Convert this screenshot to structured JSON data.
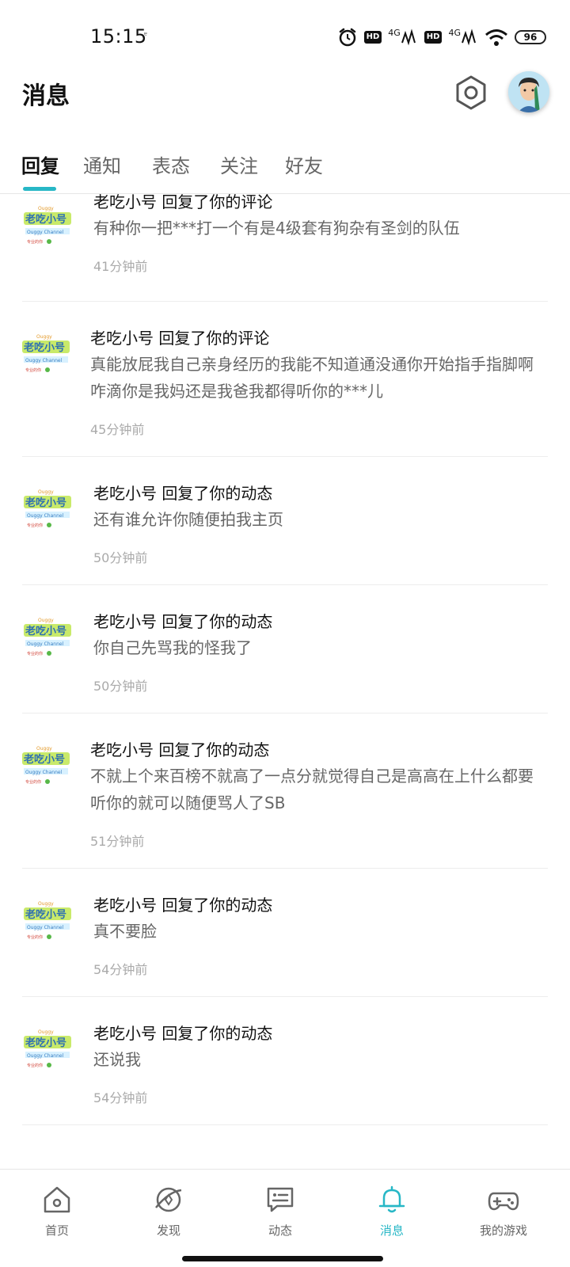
{
  "status_bar": {
    "time": "15:15",
    "extra_icon": "ᵄ",
    "hd1": "HD",
    "net1": "4G",
    "hd2": "HD",
    "net2": "4G",
    "battery": "96",
    "icons": [
      "alarm-icon",
      "hd-icon",
      "signal-icon",
      "hd-icon",
      "signal-icon",
      "wifi-icon",
      "battery-icon"
    ]
  },
  "header": {
    "title": "消息",
    "settings_icon": "gear-icon",
    "avatar_icon": "avatar-icon"
  },
  "tabs": [
    {
      "label": "回复",
      "active": true
    },
    {
      "label": "通知",
      "active": false
    },
    {
      "label": "表态",
      "active": false
    },
    {
      "label": "关注",
      "active": false
    },
    {
      "label": "好友",
      "active": false
    }
  ],
  "messages": [
    {
      "sender": "老吃小号",
      "action": "回复了你的评论",
      "title": "老吃小号 回复了你的评论",
      "body": "有种你一把***打一个有是4级套有狗杂有圣剑的队伍",
      "time": "41分钟前"
    },
    {
      "sender": "老吃小号",
      "action": "回复了你的评论",
      "title": "老吃小号 回复了你的评论",
      "body": "真能放屁我自己亲身经历的我能不知道通没通你开始指手指脚啊咋滴你是我妈还是我爸我都得听你的***儿",
      "time": "45分钟前"
    },
    {
      "sender": "老吃小号",
      "action": "回复了你的动态",
      "title": "老吃小号 回复了你的动态",
      "body": "还有谁允许你随便拍我主页",
      "time": "50分钟前"
    },
    {
      "sender": "老吃小号",
      "action": "回复了你的动态",
      "title": "老吃小号 回复了你的动态",
      "body": "你自己先骂我的怪我了",
      "time": "50分钟前"
    },
    {
      "sender": "老吃小号",
      "action": "回复了你的动态",
      "title": "老吃小号 回复了你的动态",
      "body": "不就上个来百榜不就高了一点分就觉得自己是高高在上什么都要听你的就可以随便骂人了SB",
      "time": "51分钟前"
    },
    {
      "sender": "老吃小号",
      "action": "回复了你的动态",
      "title": "老吃小号 回复了你的动态",
      "body": "真不要脸",
      "time": "54分钟前"
    },
    {
      "sender": "老吃小号",
      "action": "回复了你的动态",
      "title": "老吃小号 回复了你的动态",
      "body": "还说我",
      "time": "54分钟前"
    }
  ],
  "avatar_text": "老吃小号",
  "bottom_nav": [
    {
      "label": "首页",
      "icon": "home-icon",
      "active": false
    },
    {
      "label": "发现",
      "icon": "compass-icon",
      "active": false
    },
    {
      "label": "动态",
      "icon": "chat-icon",
      "active": false
    },
    {
      "label": "消息",
      "icon": "bell-icon",
      "active": true
    },
    {
      "label": "我的游戏",
      "icon": "gamepad-icon",
      "active": false
    }
  ],
  "colors": {
    "accent": "#27b7c6",
    "text_primary": "#111111",
    "text_secondary": "#666666",
    "text_muted": "#aaaaaa"
  }
}
